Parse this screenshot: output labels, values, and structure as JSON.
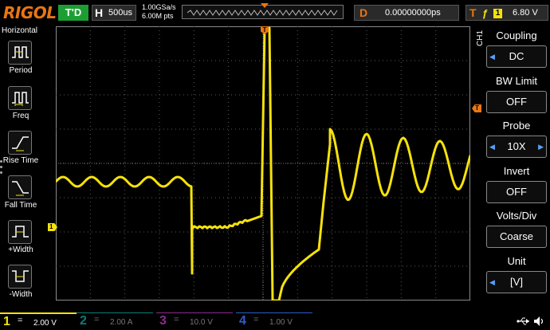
{
  "top": {
    "logo": "RIGOL",
    "run_state": "T'D",
    "horizontal_label": "H",
    "timebase": "500us",
    "sample_rate": "1.00GSa/s",
    "memory_depth": "6.00M pts",
    "delay_label": "D",
    "delay_value": "0.00000000ps",
    "trigger_label": "T",
    "trigger_edge": "ƒ",
    "trigger_source": "1",
    "trigger_level": "6.80 V"
  },
  "left_menu": {
    "title": "Horizontal",
    "items": [
      {
        "label": "Period",
        "icon": "period-icon"
      },
      {
        "label": "Freq",
        "icon": "freq-icon"
      },
      {
        "label": "Rise Time",
        "icon": "rise-time-icon"
      },
      {
        "label": "Fall Time",
        "icon": "fall-time-icon"
      },
      {
        "label": "+Width",
        "icon": "positive-width-icon"
      },
      {
        "label": "-Width",
        "icon": "negative-width-icon"
      }
    ]
  },
  "right_menu": {
    "channel": "CH1",
    "items": [
      {
        "title": "Coupling",
        "value": "DC"
      },
      {
        "title": "BW Limit",
        "value": "OFF"
      },
      {
        "title": "Probe",
        "value": "10X"
      },
      {
        "title": "Invert",
        "value": "OFF"
      },
      {
        "title": "Volts/Div",
        "value": "Coarse"
      },
      {
        "title": "Unit",
        "value": "[V]"
      }
    ]
  },
  "markers": {
    "ch1": "1",
    "trigger_top": "T",
    "trigger_level": "T"
  },
  "bottom": {
    "channels": [
      {
        "num": "1",
        "coupling": "=",
        "scale": "2.00 V",
        "color": "#f6e20a"
      },
      {
        "num": "2",
        "coupling": "=",
        "scale": "2.00 A",
        "color": "#0b7c78"
      },
      {
        "num": "3",
        "coupling": "=",
        "scale": "10.0 V",
        "color": "#8d2a8f"
      },
      {
        "num": "4",
        "coupling": "=",
        "scale": "1.00 V",
        "color": "#2d5ec8"
      }
    ]
  },
  "colors": {
    "trace": "#f6e20a",
    "accent": "#e87612",
    "running": "#1d9e33"
  }
}
